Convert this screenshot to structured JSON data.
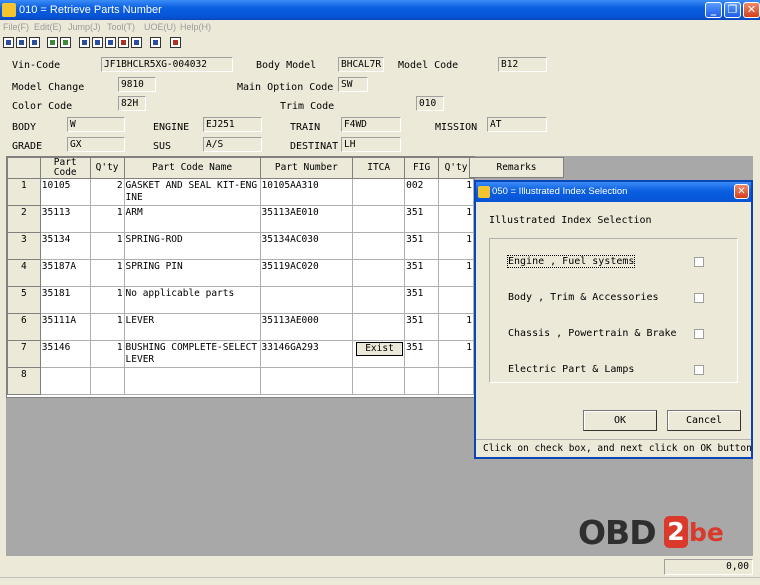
{
  "window": {
    "title": "010 = Retrieve Parts Number"
  },
  "menu": [
    "File(F)",
    "Edit(E)",
    "Jump(J)",
    "Tool(T)",
    "UOE(U)",
    "Help(H)"
  ],
  "header": {
    "vin_label": "Vin-Code",
    "vin": "JF1BHCLR5XG-004032",
    "body_model_label": "Body Model",
    "body_model": "BHCAL7R",
    "model_code_label": "Model Code",
    "model_code": "B12",
    "model_change_label": "Model Change",
    "model_change": "9810",
    "main_option_label": "Main Option Code",
    "main_option": "SW",
    "color_label": "Color Code",
    "color": "82H",
    "trim_label": "Trim Code",
    "trim": "010",
    "body_label": "BODY",
    "body": "W",
    "engine_label": "ENGINE",
    "engine": "EJ251",
    "train_label": "TRAIN",
    "train": "F4WD",
    "mission_label": "MISSION",
    "mission": "AT",
    "grade_label": "GRADE",
    "grade": "GX",
    "sus_label": "SUS",
    "sus": "A/S",
    "destinat_label": "DESTINAT",
    "destinat": "LH"
  },
  "table": {
    "columns": [
      "",
      "Part Code",
      "Q'ty",
      "Part Code Name",
      "Part Number",
      "ITCA",
      "FIG",
      "Q'ty",
      "Remarks"
    ],
    "rows": [
      {
        "no": "1",
        "part_code": "10105",
        "qty": "2",
        "name": "GASKET AND SEAL KIT-ENGINE",
        "part_number": "10105AA310",
        "itca": "",
        "fig": "002",
        "qty2": "1",
        "remarks": ""
      },
      {
        "no": "2",
        "part_code": "35113",
        "qty": "1",
        "name": "ARM",
        "part_number": "35113AE010",
        "itca": "",
        "fig": "351",
        "qty2": "1",
        "remarks": ""
      },
      {
        "no": "3",
        "part_code": "35134",
        "qty": "1",
        "name": "SPRING-ROD",
        "part_number": "35134AC030",
        "itca": "",
        "fig": "351",
        "qty2": "1",
        "remarks": ""
      },
      {
        "no": "4",
        "part_code": "35187A",
        "qty": "1",
        "name": "SPRING PIN",
        "part_number": "35119AC020",
        "itca": "",
        "fig": "351",
        "qty2": "1",
        "remarks": ""
      },
      {
        "no": "5",
        "part_code": "35181",
        "qty": "1",
        "name": "No applicable parts",
        "part_number": "",
        "itca": "",
        "fig": "351",
        "qty2": "",
        "remarks": ""
      },
      {
        "no": "6",
        "part_code": "35111A",
        "qty": "1",
        "name": "LEVER",
        "part_number": "35113AE000",
        "itca": "",
        "fig": "351",
        "qty2": "1",
        "remarks": ""
      },
      {
        "no": "7",
        "part_code": "35146",
        "qty": "1",
        "name": "BUSHING COMPLETE-SELECT LEVER",
        "part_number": "33146GA293",
        "itca": "Exist",
        "fig": "351",
        "qty2": "1",
        "remarks": ""
      },
      {
        "no": "8",
        "part_code": "",
        "qty": "",
        "name": "",
        "part_number": "",
        "itca": "",
        "fig": "",
        "qty2": "",
        "remarks": ""
      }
    ]
  },
  "dialog": {
    "title": "050 = Illustrated Index Selection",
    "heading": "Illustrated Index Selection",
    "options": [
      {
        "label": "Engine , Fuel systems",
        "checked": false
      },
      {
        "label": "Body , Trim & Accessories",
        "checked": false
      },
      {
        "label": "Chassis , Powertrain & Brake",
        "checked": false
      },
      {
        "label": "Electric Part & Lamps",
        "checked": false
      }
    ],
    "ok_label": "OK",
    "cancel_label": "Cancel",
    "hint": "Click on check box, and next click on OK button"
  },
  "logo": {
    "part1": "OBD",
    "part2": "2",
    "part3": "be"
  },
  "status": {
    "value": "0,00"
  },
  "icons": [
    "window-icon",
    "minimize-icon",
    "restore-icon",
    "close-icon",
    "dialog-icon",
    "dialog-close-icon"
  ]
}
